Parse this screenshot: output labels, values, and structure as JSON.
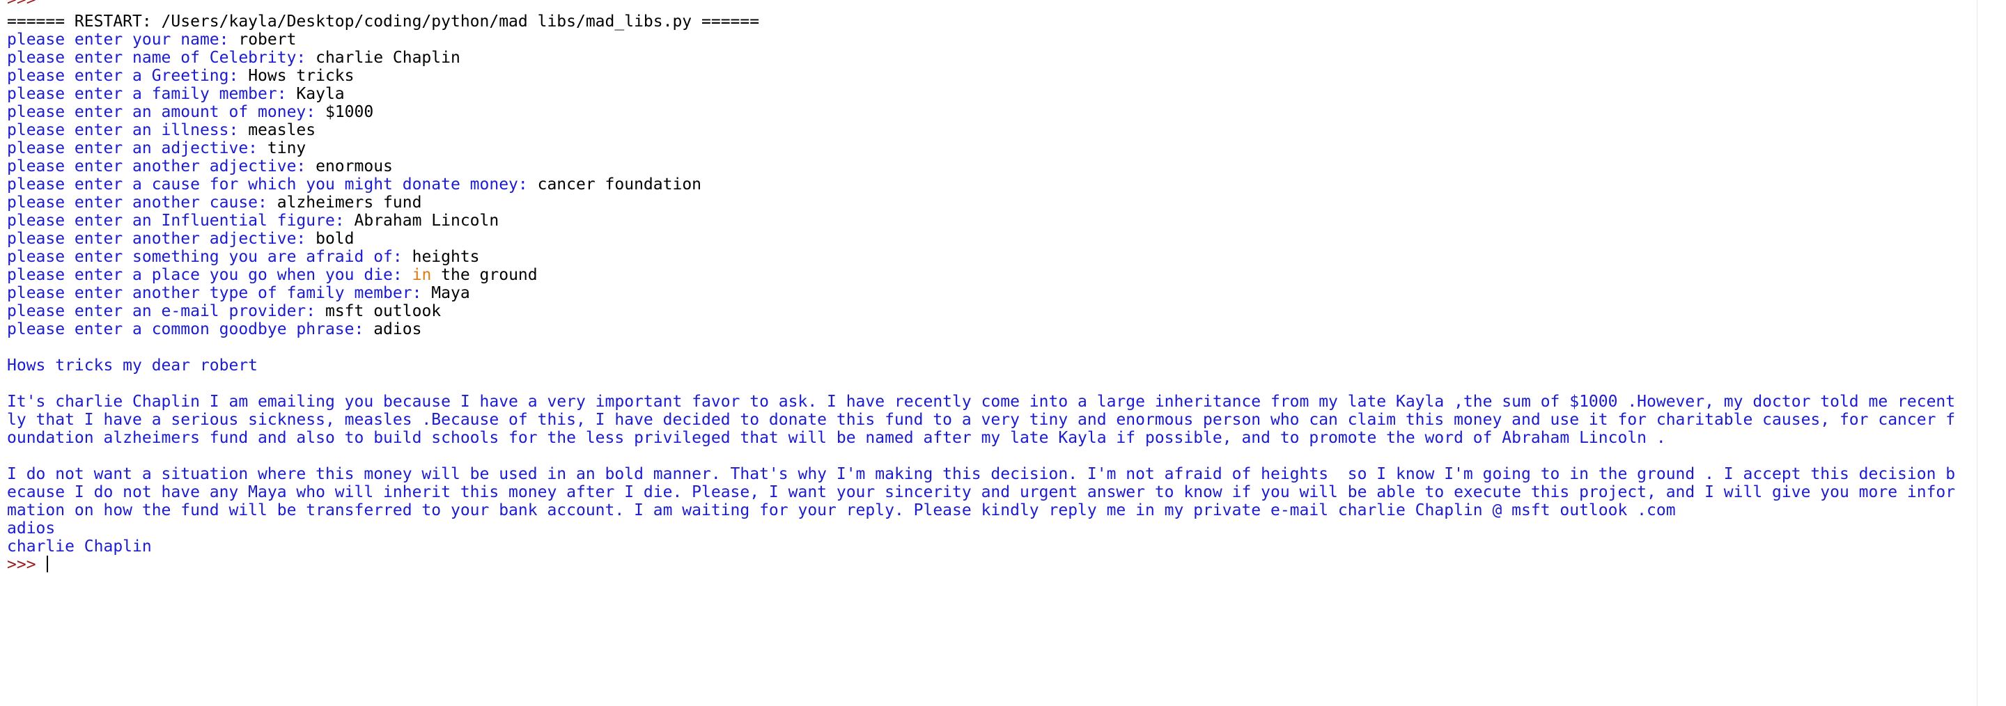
{
  "shell": {
    "top_prompt": ">>>",
    "restart_line": "====== RESTART: /Users/kayla/Desktop/coding/python/mad libs/mad_libs.py ======",
    "inputs": [
      {
        "prompt": "please enter your name: ",
        "answer": "robert"
      },
      {
        "prompt": "please enter name of Celebrity: ",
        "answer": "charlie Chaplin"
      },
      {
        "prompt": "please enter a Greeting: ",
        "answer": "Hows tricks"
      },
      {
        "prompt": "please enter a family member: ",
        "answer": "Kayla"
      },
      {
        "prompt": "please enter an amount of money: ",
        "answer": "$1000"
      },
      {
        "prompt": "please enter an illness: ",
        "answer": "measles"
      },
      {
        "prompt": "please enter an adjective: ",
        "answer": "tiny"
      },
      {
        "prompt": "please enter another adjective: ",
        "answer": "enormous"
      },
      {
        "prompt": "please enter a cause for which you might donate money: ",
        "answer": "cancer foundation"
      },
      {
        "prompt": "please enter another cause: ",
        "answer": "alzheimers fund"
      },
      {
        "prompt": "please enter an Influential figure: ",
        "answer": "Abraham Lincoln"
      },
      {
        "prompt": "please enter another adjective: ",
        "answer": "bold"
      },
      {
        "prompt": "please enter something you are afraid of: ",
        "answer": "heights"
      },
      {
        "prompt": "please enter a place you go when you die: ",
        "answer_keyword": "in",
        "answer": " the ground"
      },
      {
        "prompt": "please enter another type of family member: ",
        "answer": "Maya"
      },
      {
        "prompt": "please enter an e-mail provider: ",
        "answer": "msft outlook"
      },
      {
        "prompt": "please enter a common goodbye phrase: ",
        "answer": "adios"
      }
    ],
    "greeting_line": "Hows tricks my dear robert",
    "paragraph1": [
      "It's charlie Chaplin I am emailing you because I have a very important favor to ask. I have recently come into a large inheritance from my late Kayla ,the sum of $1000 .However, my doctor told me recent",
      "ly that I have a serious sickness, measles .Because of this, I have decided to donate this fund to a very tiny and enormous person who can claim this money and use it for charitable causes, for cancer f",
      "oundation alzheimers fund and also to build schools for the less privileged that will be named after my late Kayla if possible, and to promote the word of Abraham Lincoln ."
    ],
    "paragraph2": [
      "I do not want a situation where this money will be used in an bold manner. That's why I'm making this decision. I'm not afraid of heights  so I know I'm going to in the ground . I accept this decision b",
      "ecause I do not have any Maya who will inherit this money after I die. Please, I want your sincerity and urgent answer to know if you will be able to execute this project, and I will give you more infor",
      "mation on how the fund will be transferred to your bank account. I am waiting for your reply. Please kindly reply me in my private e-mail charlie Chaplin @ msft outlook .com"
    ],
    "signoff": "adios",
    "signature": "charlie Chaplin",
    "bottom_prompt": ">>> "
  },
  "colors": {
    "output_text": "#1c1ccf",
    "input_text": "#000000",
    "keyword": "#e07b10",
    "prompt": "#9a1a1a",
    "background": "#ffffff"
  }
}
